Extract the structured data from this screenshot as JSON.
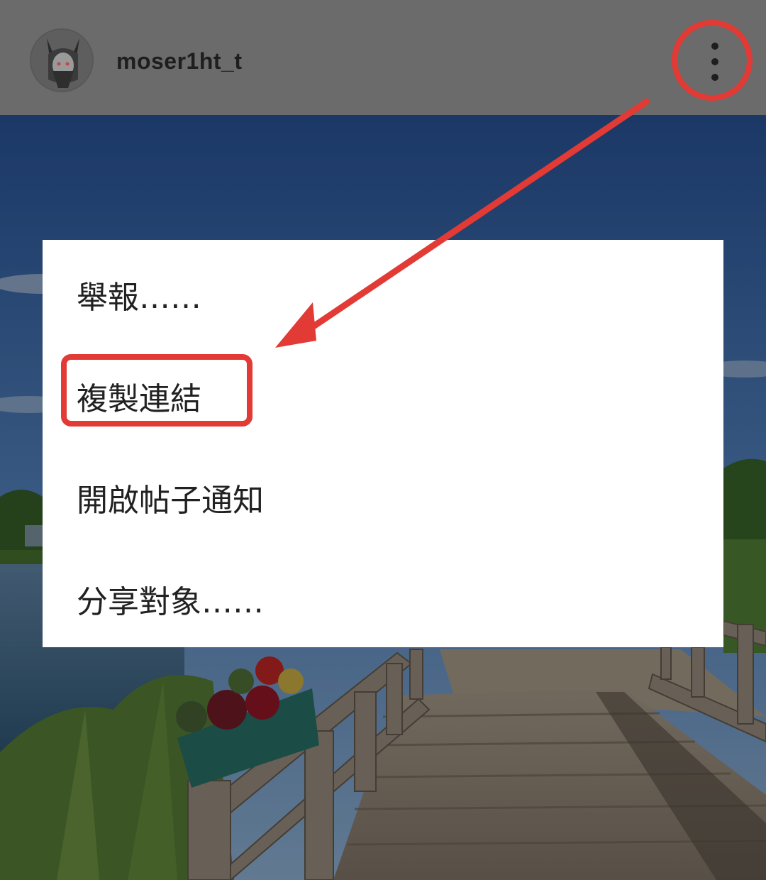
{
  "header": {
    "username": "moser1ht_t",
    "avatar_icon": "demon-avatar-icon",
    "more_icon": "vertical-dots-icon"
  },
  "menu": {
    "items": [
      {
        "label": "舉報……"
      },
      {
        "label": "複製連結"
      },
      {
        "label": "開啟帖子通知"
      },
      {
        "label": "分享對象……"
      }
    ]
  },
  "annotation": {
    "color": "#e23a35",
    "highlight_item_index": 1
  },
  "colors": {
    "header_bg": "#6b6b6b",
    "menu_bg": "#ffffff",
    "text": "#212121"
  }
}
